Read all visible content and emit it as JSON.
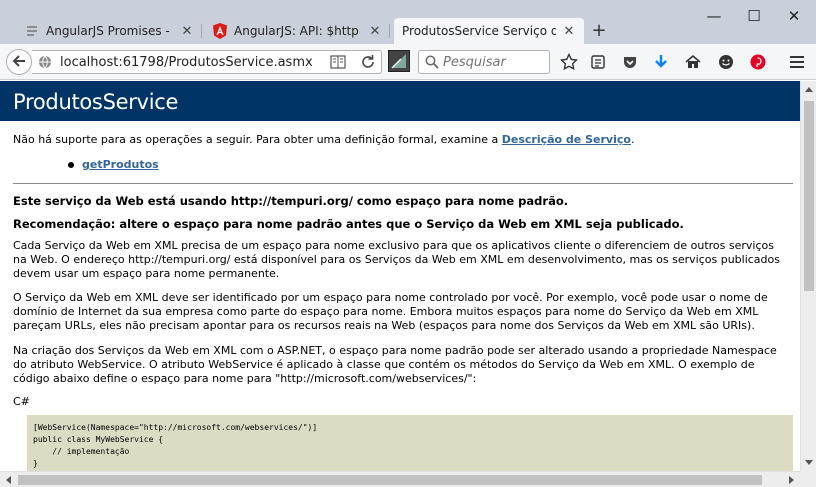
{
  "window": {
    "tabs": [
      {
        "title": "AngularJS Promises - O g...",
        "icon": "document-icon"
      },
      {
        "title": "AngularJS: API: $http",
        "icon": "angular-icon"
      },
      {
        "title": "ProdutosService Serviço da Web",
        "icon": "none"
      }
    ],
    "active_tab_index": 2,
    "controls": {
      "minimize": "—",
      "maximize": "☐",
      "close": "✕"
    }
  },
  "toolbar": {
    "url": "localhost:61798/ProdutosService.asmx",
    "search_placeholder": "Pesquisar"
  },
  "page": {
    "title": "ProdutosService",
    "intro_text": "Não há suporte para as operações a seguir. Para obter uma definição formal, examine a ",
    "intro_link": "Descrição de Serviço",
    "intro_end": ".",
    "operations": [
      "getProdutos"
    ],
    "heading1": "Este serviço da Web está usando http://tempuri.org/ como espaço para nome padrão.",
    "heading2": "Recomendação: altere o espaço para nome padrão antes que o Serviço da Web em XML seja publicado.",
    "para1": "Cada Serviço da Web em XML precisa de um espaço para nome exclusivo para que os aplicativos cliente o diferenciem de outros serviços na Web. O endereço http://tempuri.org/ está disponível para os Serviços da Web em XML em desenvolvimento, mas os serviços publicados devem usar um espaço para nome permanente.",
    "para2": "O Serviço da Web em XML deve ser identificado por um espaço para nome controlado por você. Por exemplo, você pode usar o nome de domínio de Internet da sua empresa como parte do espaço para nome. Embora muitos espaços para nome do Serviço da Web em XML pareçam URLs, eles não precisam apontar para os recursos reais na Web (espaços para nome dos Serviços da Web em XML são URIs).",
    "para3": "Na criação dos Serviços da Web em XML com o ASP.NET, o espaço para nome padrão pode ser alterado usando a propriedade Namespace do atributo WebService. O atributo WebService é aplicado à classe que contém os métodos do Serviço da Web em XML. O exemplo de código abaixo define o espaço para nome para \"http://microsoft.com/webservices/\":",
    "code_lang": "C#",
    "code_lines": [
      "[WebService(Namespace=\"http://microsoft.com/webservices/\")]",
      "public class MyWebService {",
      "    // implementação",
      "}"
    ]
  },
  "colors": {
    "banner": "#003366",
    "link": "#336699",
    "code_bg": "#dcdcc5",
    "tabstrip": "#c9d0db"
  }
}
